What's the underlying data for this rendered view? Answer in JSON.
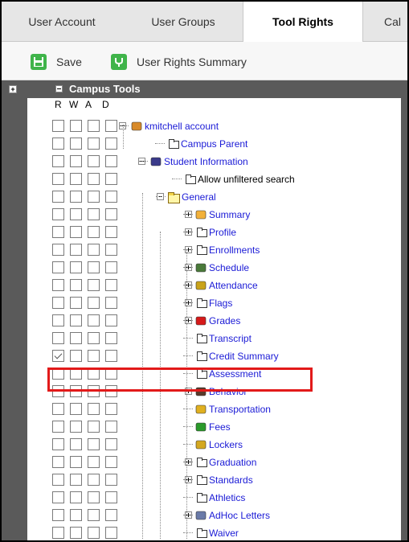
{
  "tabs": [
    {
      "label": "User Account",
      "active": false
    },
    {
      "label": "User Groups",
      "active": false
    },
    {
      "label": "Tool Rights",
      "active": true
    },
    {
      "label": "Cal",
      "active": false
    }
  ],
  "toolbar": {
    "save_label": "Save",
    "summary_label": "User Rights Summary"
  },
  "panel": {
    "title": "Campus Tools",
    "columns": [
      "R",
      "W",
      "A",
      "D"
    ]
  },
  "tree": [
    {
      "label": "kmitchell account",
      "icon": "user-account-icon",
      "checked": [
        false,
        false,
        false,
        false
      ]
    },
    {
      "label": "Campus Parent",
      "icon": "page-icon",
      "checked": [
        false,
        false,
        false,
        false
      ]
    },
    {
      "label": "Student Information",
      "icon": "student-info-icon",
      "checked": [
        false,
        false,
        false,
        false
      ]
    },
    {
      "label": "Allow unfiltered search",
      "icon": "page-icon",
      "checked": [
        false,
        false,
        false,
        false
      ]
    },
    {
      "label": "General",
      "icon": "folder-icon",
      "checked": [
        false,
        false,
        false,
        false
      ]
    },
    {
      "label": "Summary",
      "icon": "summary-icon",
      "checked": [
        false,
        false,
        false,
        false
      ]
    },
    {
      "label": "Profile",
      "icon": "page-icon",
      "checked": [
        false,
        false,
        false,
        false
      ]
    },
    {
      "label": "Enrollments",
      "icon": "page-icon",
      "checked": [
        false,
        false,
        false,
        false
      ]
    },
    {
      "label": "Schedule",
      "icon": "schedule-icon",
      "checked": [
        false,
        false,
        false,
        false
      ]
    },
    {
      "label": "Attendance",
      "icon": "attendance-icon",
      "checked": [
        false,
        false,
        false,
        false
      ]
    },
    {
      "label": "Flags",
      "icon": "page-icon",
      "checked": [
        false,
        false,
        false,
        false
      ]
    },
    {
      "label": "Grades",
      "icon": "grades-icon",
      "checked": [
        false,
        false,
        false,
        false
      ]
    },
    {
      "label": "Transcript",
      "icon": "page-icon",
      "checked": [
        false,
        false,
        false,
        false
      ]
    },
    {
      "label": "Credit Summary",
      "icon": "page-icon",
      "checked": [
        true,
        false,
        false,
        false
      ]
    },
    {
      "label": "Assessment",
      "icon": "page-icon",
      "checked": [
        false,
        false,
        false,
        false
      ]
    },
    {
      "label": "Behavior",
      "icon": "behavior-icon",
      "checked": [
        false,
        false,
        false,
        false
      ]
    },
    {
      "label": "Transportation",
      "icon": "transportation-icon",
      "checked": [
        false,
        false,
        false,
        false
      ]
    },
    {
      "label": "Fees",
      "icon": "fees-icon",
      "checked": [
        false,
        false,
        false,
        false
      ]
    },
    {
      "label": "Lockers",
      "icon": "lockers-icon",
      "checked": [
        false,
        false,
        false,
        false
      ]
    },
    {
      "label": "Graduation",
      "icon": "page-icon",
      "checked": [
        false,
        false,
        false,
        false
      ]
    },
    {
      "label": "Standards",
      "icon": "page-icon",
      "checked": [
        false,
        false,
        false,
        false
      ]
    },
    {
      "label": "Athletics",
      "icon": "page-icon",
      "checked": [
        false,
        false,
        false,
        false
      ]
    },
    {
      "label": "AdHoc Letters",
      "icon": "adhoc-letters-icon",
      "checked": [
        false,
        false,
        false,
        false
      ]
    },
    {
      "label": "Waiver",
      "icon": "page-icon",
      "checked": [
        false,
        false,
        false,
        false
      ]
    }
  ],
  "colors": {
    "highlight": "#e21a1a",
    "link": "#1a1ad6",
    "panel_header": "#5a5a5a",
    "save_green": "#3fb44a"
  }
}
